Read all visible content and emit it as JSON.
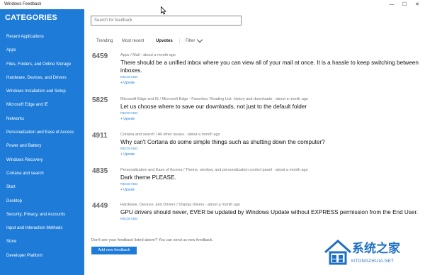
{
  "window": {
    "title": "Windows Feedback",
    "minimize": "—",
    "maximize": "☐",
    "close": "✕"
  },
  "sidebar": {
    "heading": "CATEGORIES",
    "items": [
      "Recent Applications",
      "Apps",
      "Files, Folders, and Online Storage",
      "Hardware, Devices, and Drivers",
      "Windows Installation and Setup",
      "Microsoft Edge and IE",
      "Networks",
      "Personalization and Ease of Access",
      "Power and Battery",
      "Windows Recovery",
      "Cortana and search",
      "Start",
      "Desktop",
      "Security, Privacy, and Accounts",
      "Input and Interaction Methods",
      "Store",
      "Developer Platform"
    ]
  },
  "search": {
    "placeholder": "Search for feedback"
  },
  "tabs": {
    "trending": "Trending",
    "most_recent": "Most recent",
    "upvotes": "Upvotes",
    "separator": "|",
    "filter": "Filter"
  },
  "feedback": [
    {
      "votes": "6459",
      "meta": "Apps / Mail - about a month ago",
      "text": "There should be a unified inbox where you can view all of your mail at once. It is a hassle to keep switching between inboxes.",
      "status": "RECEIVED",
      "upvote": "+ Upvote"
    },
    {
      "votes": "5825",
      "meta": "Microsoft Edge and IE / Microsoft Edge - Favorites, Reading List, history and downloads - about a month ago",
      "text": "Let us choose where to save our downloads, not just to the default folder",
      "status": "RECEIVED",
      "upvote": "+ Upvote"
    },
    {
      "votes": "4911",
      "meta": "Cortana and search / All other issues - about a month ago",
      "text": "Why can't Cortana do some simple things such as shutting down the computer?",
      "status": "RECEIVED",
      "upvote": "+ Upvote"
    },
    {
      "votes": "4835",
      "meta": "Personalization and Ease of Access / Theme, window, and personalization control panel - about a month ago",
      "text": "Dark theme PLEASE.",
      "status": "RECEIVED",
      "upvote": "+ Upvote"
    },
    {
      "votes": "4449",
      "meta": "Hardware, Devices, and Drivers / Display drivers - about a month ago",
      "text": "GPU drivers should never, EVER be updated by Windows Update without EXPRESS permission from the End User.",
      "status": "RECEIVED",
      "upvote": ""
    }
  ],
  "footer": {
    "text": "Don't see your feedback listed above? You can send us new feedback.",
    "button": "Add new feedback"
  },
  "watermark": {
    "title": "系统之家",
    "url": "XITONGZHIJIA.NET"
  },
  "colors": {
    "accent": "#1e7bd7",
    "status": "#2a87d8"
  }
}
